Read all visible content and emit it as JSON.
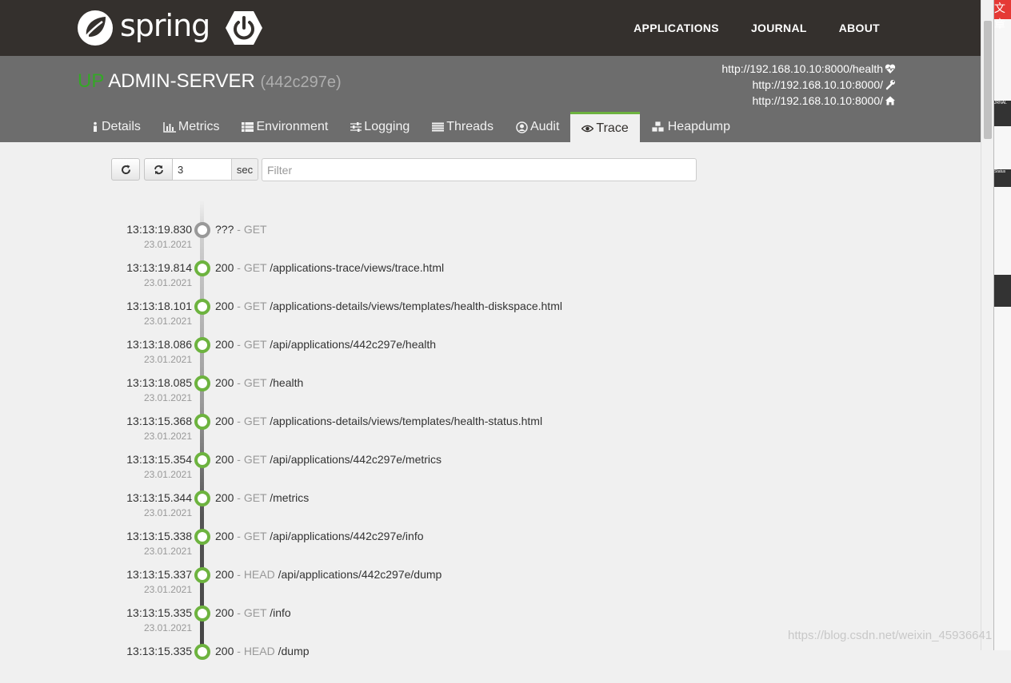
{
  "brand": {
    "name": "spring"
  },
  "nav": {
    "applications": "APPLICATIONS",
    "journal": "JOURNAL",
    "about": "ABOUT"
  },
  "app": {
    "status": "UP",
    "name": "ADMIN-SERVER",
    "id": "(442c297e)"
  },
  "urls": {
    "health": "http://192.168.10.10:8000/health",
    "management": "http://192.168.10.10:8000/",
    "service": "http://192.168.10.10:8000/"
  },
  "tabs": [
    {
      "label": "Details",
      "icon": "info-icon"
    },
    {
      "label": "Metrics",
      "icon": "bar-chart-icon"
    },
    {
      "label": "Environment",
      "icon": "list-icon"
    },
    {
      "label": "Logging",
      "icon": "sliders-icon"
    },
    {
      "label": "Threads",
      "icon": "threads-icon"
    },
    {
      "label": "Audit",
      "icon": "user-circle-icon"
    },
    {
      "label": "Trace",
      "icon": "eye-icon",
      "active": true
    },
    {
      "label": "Heapdump",
      "icon": "cubes-icon"
    }
  ],
  "toolbar": {
    "interval": "3",
    "unit": "sec",
    "filter_placeholder": "Filter"
  },
  "traces": [
    {
      "time": "13:13:19.830",
      "date": "23.01.2021",
      "status": "???",
      "method": "GET",
      "path": ""
    },
    {
      "time": "13:13:19.814",
      "date": "23.01.2021",
      "status": "200",
      "method": "GET",
      "path": "/applications-trace/views/trace.html"
    },
    {
      "time": "13:13:18.101",
      "date": "23.01.2021",
      "status": "200",
      "method": "GET",
      "path": "/applications-details/views/templates/health-diskspace.html"
    },
    {
      "time": "13:13:18.086",
      "date": "23.01.2021",
      "status": "200",
      "method": "GET",
      "path": "/api/applications/442c297e/health"
    },
    {
      "time": "13:13:18.085",
      "date": "23.01.2021",
      "status": "200",
      "method": "GET",
      "path": "/health"
    },
    {
      "time": "13:13:15.368",
      "date": "23.01.2021",
      "status": "200",
      "method": "GET",
      "path": "/applications-details/views/templates/health-status.html"
    },
    {
      "time": "13:13:15.354",
      "date": "23.01.2021",
      "status": "200",
      "method": "GET",
      "path": "/api/applications/442c297e/metrics"
    },
    {
      "time": "13:13:15.344",
      "date": "23.01.2021",
      "status": "200",
      "method": "GET",
      "path": "/metrics"
    },
    {
      "time": "13:13:15.338",
      "date": "23.01.2021",
      "status": "200",
      "method": "GET",
      "path": "/api/applications/442c297e/info"
    },
    {
      "time": "13:13:15.337",
      "date": "23.01.2021",
      "status": "200",
      "method": "HEAD",
      "path": "/api/applications/442c297e/dump"
    },
    {
      "time": "13:13:15.335",
      "date": "23.01.2021",
      "status": "200",
      "method": "GET",
      "path": "/info"
    },
    {
      "time": "13:13:15.335",
      "date": "",
      "status": "200",
      "method": "HEAD",
      "path": "/dump"
    }
  ],
  "side": {
    "top": "文章",
    "b1": "JRNAL",
    "b2": "Status"
  },
  "watermark": "https://blog.csdn.net/weixin_45936641",
  "colors": {
    "up": "#34a826",
    "accent": "#6db33f",
    "navbar": "#34302d",
    "header": "#6d6d6d"
  }
}
